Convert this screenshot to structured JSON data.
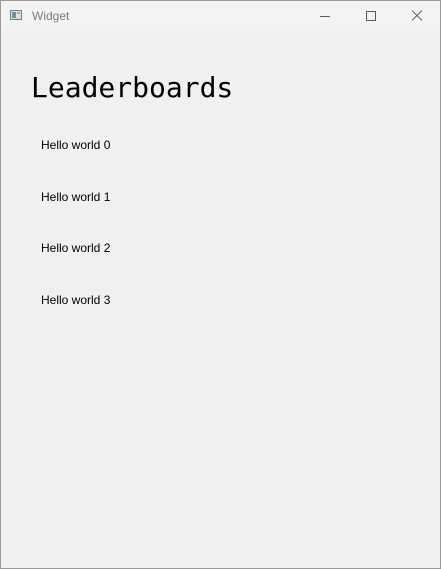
{
  "window": {
    "title": "Widget"
  },
  "window_controls": {
    "minimize_icon": "minimize-icon",
    "maximize_icon": "maximize-icon",
    "close_icon": "close-icon"
  },
  "main": {
    "heading": "Leaderboards",
    "items": [
      {
        "label": "Hello world 0"
      },
      {
        "label": "Hello world 1"
      },
      {
        "label": "Hello world 2"
      },
      {
        "label": "Hello world 3"
      }
    ]
  }
}
